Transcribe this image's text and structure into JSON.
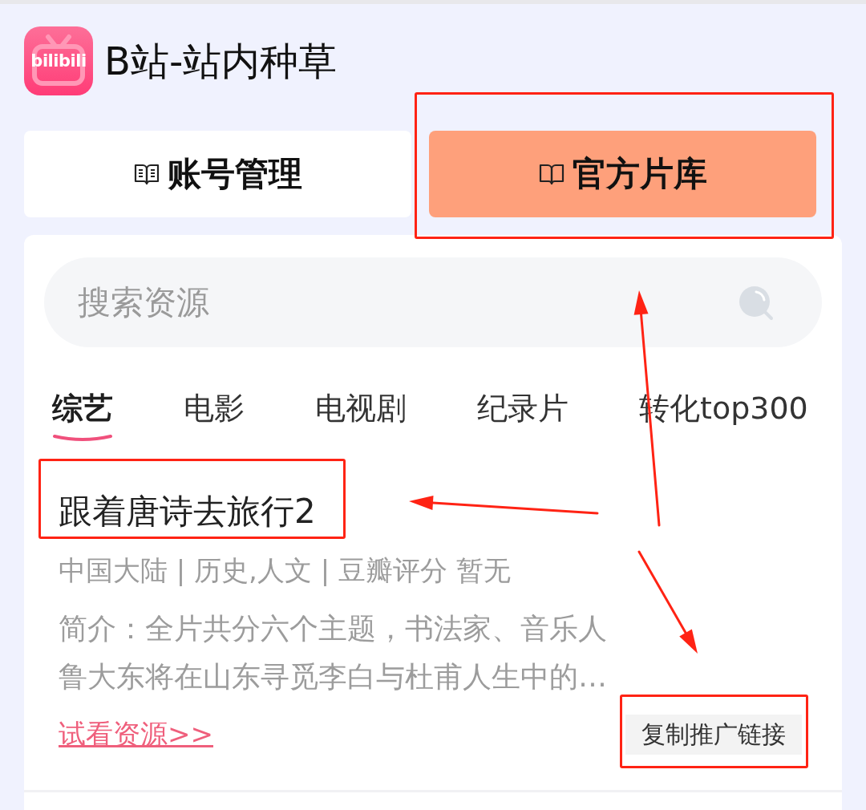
{
  "header": {
    "logo_text": "bilibili",
    "title": "B站-站内种草"
  },
  "tabs": [
    {
      "label": "账号管理",
      "selected": false,
      "highlighted": false
    },
    {
      "label": "官方片库",
      "selected": true,
      "highlighted": true
    }
  ],
  "search": {
    "placeholder": "搜索资源"
  },
  "categories": [
    {
      "label": "综艺",
      "selected": true
    },
    {
      "label": "电影",
      "selected": false
    },
    {
      "label": "电视剧",
      "selected": false
    },
    {
      "label": "纪录片",
      "selected": false
    },
    {
      "label": "转化top300",
      "selected": false
    }
  ],
  "items": [
    {
      "title": "跟着唐诗去旅行2",
      "title_highlighted": true,
      "meta": "中国大陆 | 历史,人文 | 豆瓣评分 暂无",
      "description": "简介：全片共分六个主题，书法家、音乐人鲁大东将在山东寻觅李白与杜甫人生中的…",
      "link": "试看资源>>",
      "copy_button": "复制推广链接",
      "copy_highlighted": true
    }
  ]
}
